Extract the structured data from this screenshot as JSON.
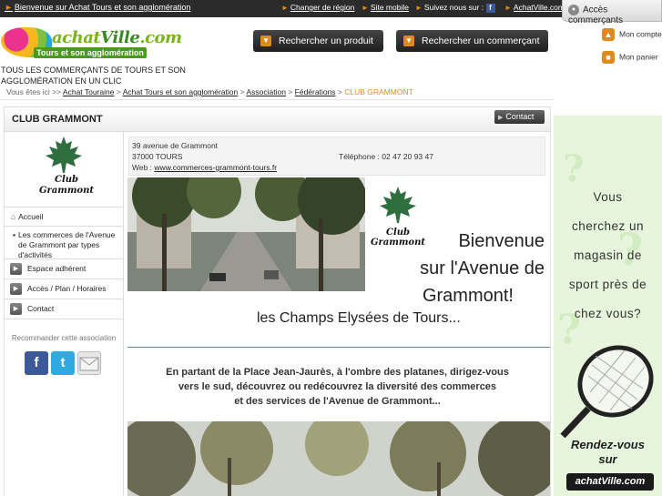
{
  "topbar": {
    "home_link": "Bienvenue sur Achat Tours et son agglomération",
    "change_region": "Changer de région",
    "mobile_site": "Site mobile",
    "follow_us": "Suivez nous sur :",
    "achatville": "AchatVille.com",
    "merchant_access": "Accès commerçants"
  },
  "header": {
    "logo_text_a": "achat",
    "logo_text_b": "Ville",
    "logo_text_c": ".com",
    "logo_sub": "Tours et son agglomération",
    "tagline": "TOUS LES COMMERÇANTS DE TOURS ET SON AGGLOMÉRATION EN UN CLIC",
    "search_product": "Rechercher un produit",
    "search_merchant": "Rechercher un commerçant",
    "my_account": "Mon compte",
    "my_cart": "Mon panier"
  },
  "breadcrumb": {
    "prefix": "Vous êtes ici >>",
    "items": [
      "Achat Touraine",
      "Achat Tours et son agglomération",
      "Association",
      "Fédérations"
    ],
    "current": "CLUB GRAMMONT",
    "separator": ">"
  },
  "page": {
    "title": "CLUB GRAMMONT",
    "contact_button": "Contact"
  },
  "club_logo": {
    "line1": "Club",
    "line2": "Grammont"
  },
  "sidebar": {
    "items": [
      "Accueil",
      "Les commerces de l'Avenue de Grammont par types d'activités",
      "Espace adhérent",
      "Accès / Plan / Horaires",
      "Contact"
    ],
    "recommend": "Recommander cette association"
  },
  "address": {
    "street": "39 avenue de Grammont",
    "city": "37000 TOURS",
    "phone": "Téléphone : 02 47 20 93 47",
    "web_label": "Web :",
    "web_url": "www.commerces-grammont-tours.fr"
  },
  "welcome": {
    "line1": "Bienvenue",
    "line2": "sur l'Avenue de",
    "line3": "Grammont!",
    "slogan": "les Champs Elysées de Tours...",
    "intro_1": "En partant de la Place Jean-Jaurès, à l'ombre des platanes, dirigez-vous",
    "intro_2": "vers le sud, découvrez ou redécouvrez la diversité des commerces",
    "intro_3": "et des services de l'Avenue de Grammont..."
  },
  "ad": {
    "line1": "Vous",
    "line2": "cherchez un",
    "line3": "magasin de",
    "line4": "sport près de",
    "line5": "chez vous?",
    "cta1": "Rendez-vous",
    "cta2": "sur",
    "brand": "achatVille.com"
  },
  "colors": {
    "accent_orange": "#e08a1e",
    "topbar": "#2b2b2b",
    "ad_background": "#e6f5dc"
  }
}
